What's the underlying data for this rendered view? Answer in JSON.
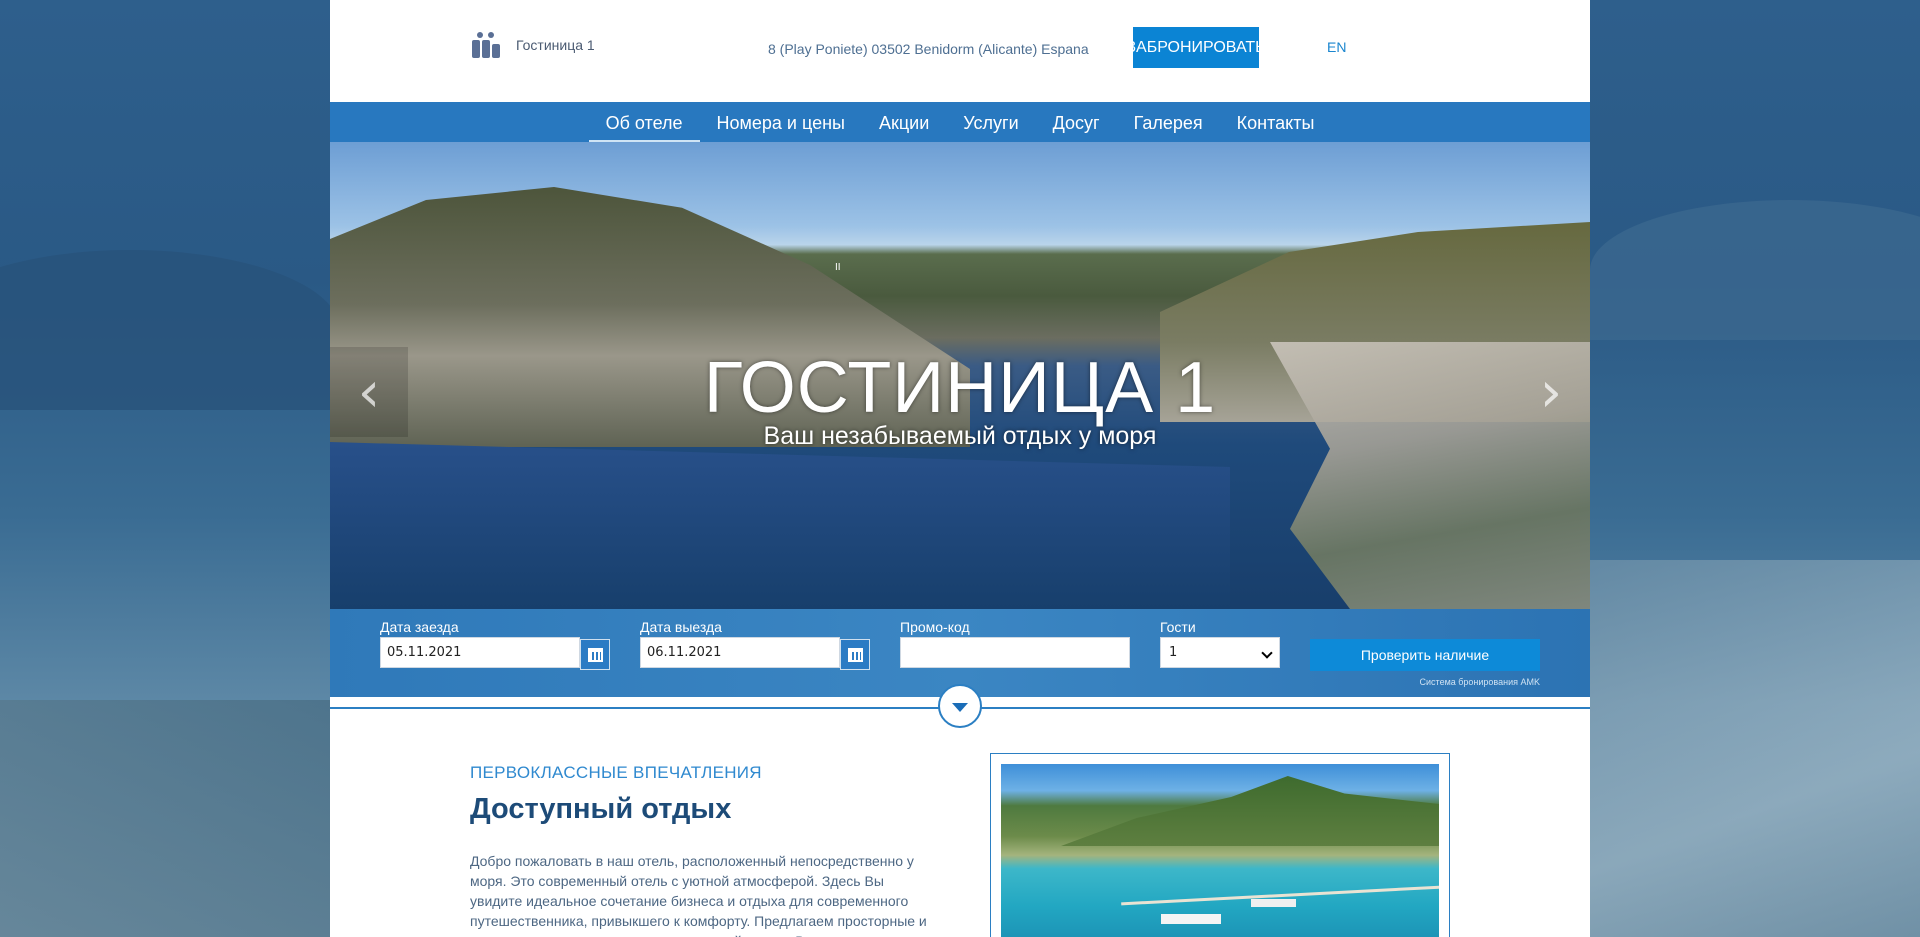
{
  "header": {
    "hotel_name": "Гостиница 1",
    "address": "8 (Play Poniete) 03502 Benidorm (Alicante) Espana",
    "book_label": "ЗАБРОНИРОВАТЬ",
    "lang": "EN"
  },
  "nav": {
    "items": [
      "Об отеле",
      "Номера и цены",
      "Акции",
      "Услуги",
      "Досуг",
      "Галерея",
      "Контакты"
    ],
    "active": "Об отеле"
  },
  "hero": {
    "title": "ГОСТИНИЦА 1",
    "subtitle": "Ваш незабываемый отдых у моря",
    "pause_glyph": "II",
    "prev_glyph": "‹",
    "next_glyph": "›"
  },
  "booking": {
    "checkin_label": "Дата заезда",
    "checkin_value": "05.11.2021",
    "checkout_label": "Дата выезда",
    "checkout_value": "06.11.2021",
    "promo_label": "Промо-код",
    "promo_value": "",
    "guests_label": "Гости",
    "guests_value": "1",
    "check_label": "Проверить наличие",
    "powered": "Система бронирования AMK"
  },
  "content": {
    "kicker": "ПЕРВОКЛАССНЫЕ ВПЕЧАТЛЕНИЯ",
    "heading": "Доступный отдых",
    "paragraph": "Добро пожаловать в наш отель, расположенный непосредственно у моря. Это современный отель с уютной атмосферой. Здесь Вы увидите идеальное сочетание бизнеса и отдыха для современного путешественника, привыкшего к комфорту. Предлагаем просторные и уютные номера, которые идеально подойдут для Вашего комфортного"
  },
  "colors": {
    "accent": "#0b84d4",
    "nav_bg": "#2878bf",
    "heading": "#1d4b78"
  }
}
